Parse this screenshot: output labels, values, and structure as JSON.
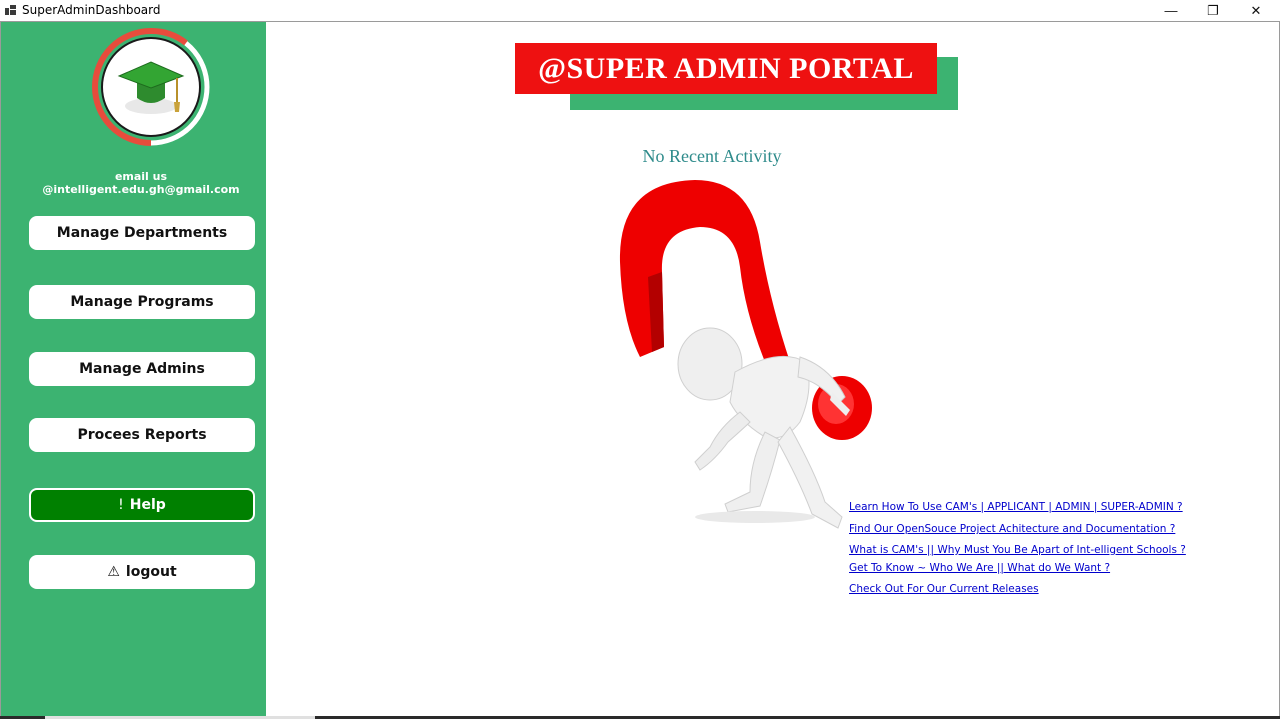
{
  "window": {
    "title": "SuperAdminDashboard",
    "controls": {
      "minimize": "—",
      "restore": "❐",
      "close": "✕"
    }
  },
  "sidebar": {
    "email_text": "email us @intelligent.edu.gh@gmail.com",
    "buttons": [
      {
        "label": "Manage Departments"
      },
      {
        "label": "Manage Programs"
      },
      {
        "label": "Manage Admins"
      },
      {
        "label": "Procees Reports"
      },
      {
        "label": "Help",
        "glyph": "!"
      },
      {
        "label": "logout",
        "glyph": "⚠"
      }
    ]
  },
  "main": {
    "banner_title": "@SUPER ADMIN PORTAL",
    "activity_text": "No Recent Activity",
    "illustration_icon": "question-mark-figure-icon",
    "links": [
      {
        "label": "Learn How To Use CAM's | APPLICANT | ADMIN | SUPER-ADMIN ?"
      },
      {
        "label": "Find Our OpenSouce Project Achitecture and Documentation ?"
      },
      {
        "label": "What is CAM's || Why Must You Be Apart of Int-elligent Schools ?"
      },
      {
        "label": "Get To Know ~ Who We Are || What do We Want ?"
      },
      {
        "label": "Check Out For Our Current Releases"
      }
    ]
  },
  "colors": {
    "sidebar_green": "#3cb371",
    "banner_red": "#ee1111",
    "help_green": "#008000",
    "link_blue": "#0000cc",
    "activity_teal": "#2e8b8b"
  }
}
